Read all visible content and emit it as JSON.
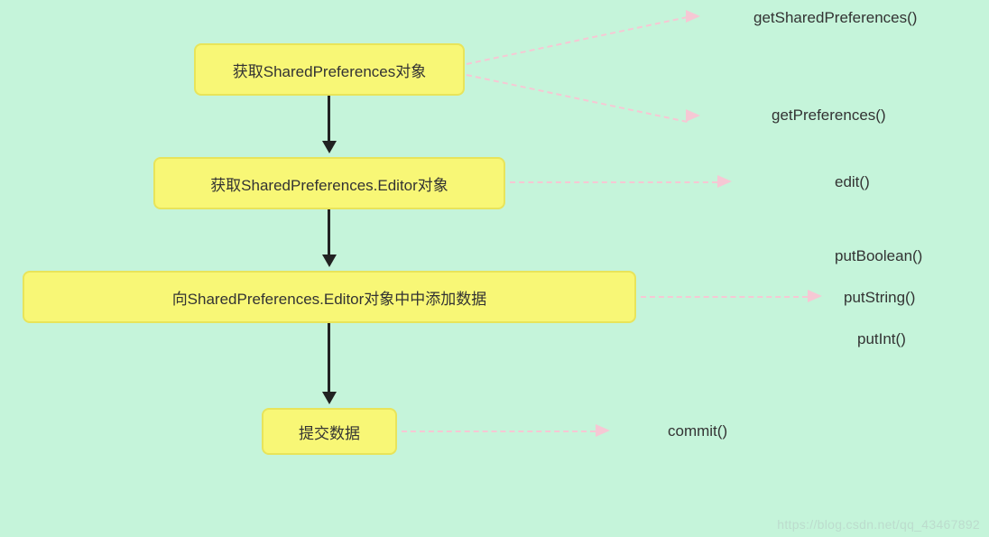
{
  "nodes": {
    "n1": "获取SharedPreferences对象",
    "n2": "获取SharedPreferences.Editor对象",
    "n3": "向SharedPreferences.Editor对象中中添加数据",
    "n4": "提交数据"
  },
  "methods": {
    "m1a": "getSharedPreferences()",
    "m1b": "getPreferences()",
    "m2": "edit()",
    "m3a": "putBoolean()",
    "m3b": "putString()",
    "m3c": "putInt()",
    "m4": "commit()"
  },
  "watermark": "https://blog.csdn.net/qq_43467892"
}
